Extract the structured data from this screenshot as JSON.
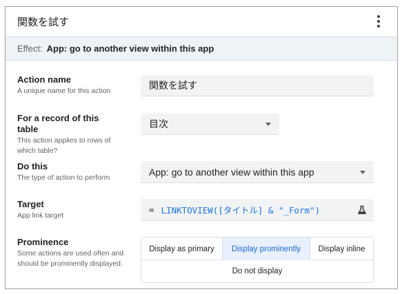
{
  "panel": {
    "title": "関数を試す"
  },
  "effect": {
    "label": "Effect:",
    "value": "App: go to another view within this app"
  },
  "rows": {
    "action_name": {
      "label": "Action name",
      "help": "A unique name for this action",
      "value": "関数を試す"
    },
    "table": {
      "label": "For a record of this table",
      "help": "This action applies to rows of which table?",
      "value": "目次"
    },
    "do_this": {
      "label": "Do this",
      "help": "The type of action to perform",
      "value": "App: go to another view within this app"
    },
    "target": {
      "label": "Target",
      "help": "App link target",
      "eq": "=",
      "formula": "LINKTOVIEW([タイトル] & \"_Form\")"
    },
    "prominence": {
      "label": "Prominence",
      "help": "Some actions are used often and should be prominently displayed.",
      "options": [
        "Display as primary",
        "Display prominently",
        "Display inline",
        "Do not display"
      ],
      "selected": "Display prominently"
    }
  },
  "icons": {
    "menu": "more-vert-icon",
    "dropdown": "caret-down-icon",
    "formula_test": "flask-icon"
  },
  "colors": {
    "effect_bg": "#eef3f8",
    "field_bg": "#f1f3f4",
    "formula": "#1a73e8",
    "selected_bg": "#e8f0fe",
    "selected_text": "#1967d2"
  }
}
